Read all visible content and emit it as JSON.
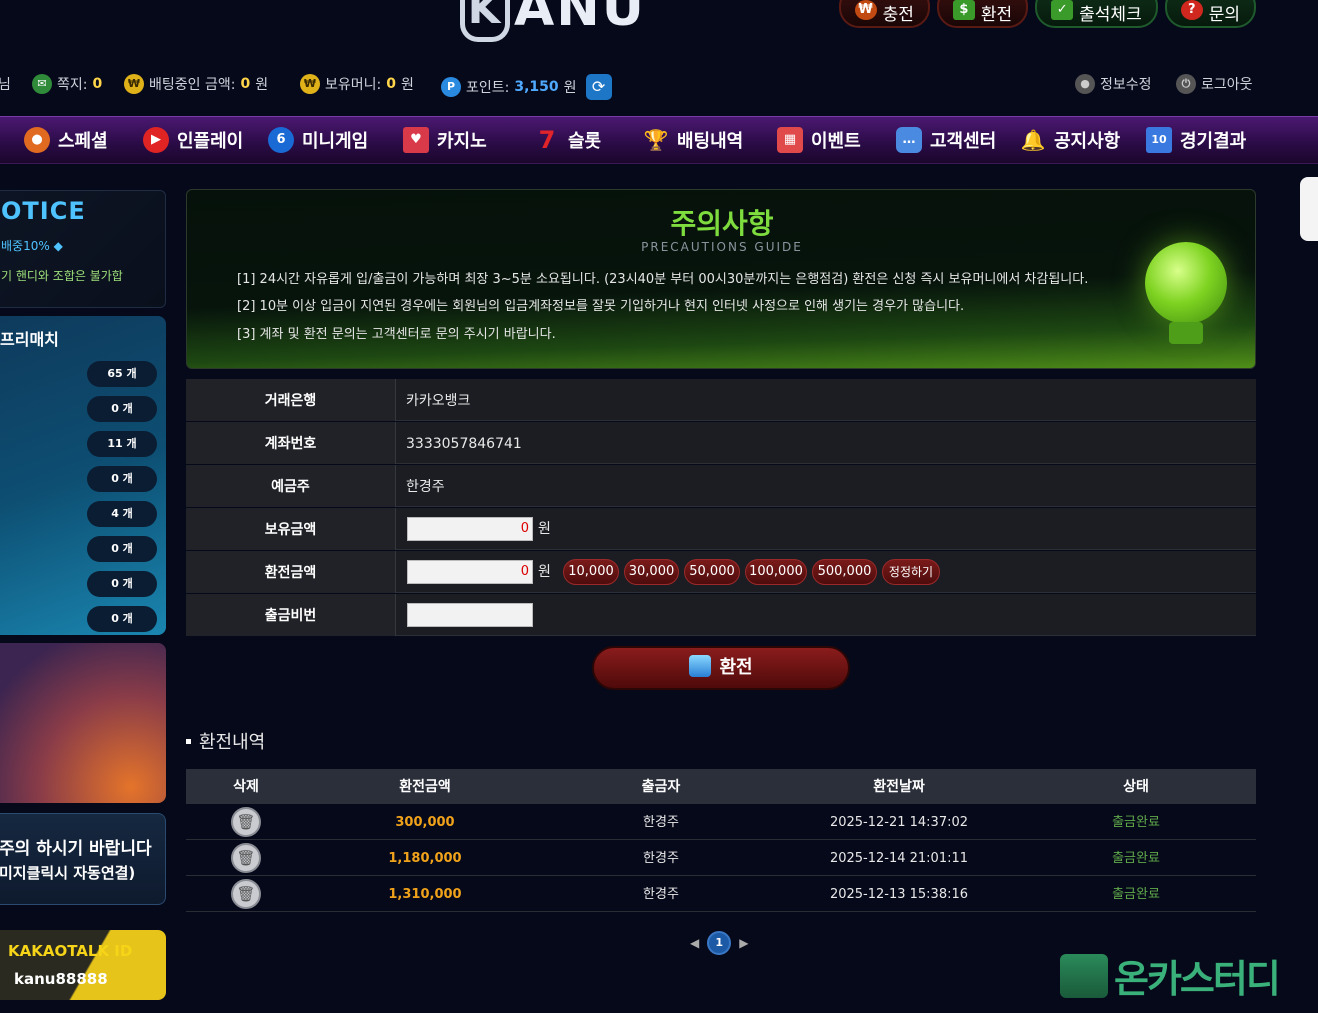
{
  "header": {
    "logo_text": "ANU",
    "top_buttons": [
      {
        "label": "충전",
        "icon": "charge-icon",
        "color": "#c14a12"
      },
      {
        "label": "환전",
        "icon": "exchange-icon",
        "color": "#3a9a2a"
      },
      {
        "label": "출석체크",
        "icon": "attendance-icon",
        "color": "#3a9a2a"
      },
      {
        "label": "문의",
        "icon": "question-icon",
        "color": "#d0281e"
      }
    ]
  },
  "infobar": {
    "user_suffix": "님",
    "messages_label": "쪽지:",
    "messages_value": "0",
    "betting_label": "배팅중인 금액:",
    "betting_value": "0",
    "betting_unit": "원",
    "money_label": "보유머니:",
    "money_value": "0",
    "money_unit": "원",
    "point_label": "포인트:",
    "point_value": "3,150",
    "point_unit": "원",
    "edit_profile": "정보수정",
    "logout": "로그아웃"
  },
  "nav": [
    {
      "label": "스페셜",
      "icon": "basketball-icon",
      "color": "#e06a20"
    },
    {
      "label": "인플레이",
      "icon": "play-icon",
      "color": "#e02424"
    },
    {
      "label": "미니게임",
      "icon": "six-ball-icon",
      "color": "#1a6ad6"
    },
    {
      "label": "카지노",
      "icon": "cards-icon",
      "color": "#d83a4a"
    },
    {
      "label": "슬롯",
      "icon": "seven-icon",
      "color": "#e0242a"
    },
    {
      "label": "배팅내역",
      "icon": "trophy-icon",
      "color": "#e0a21a"
    },
    {
      "label": "이벤트",
      "icon": "calendar-icon",
      "color": "#e04a4a"
    },
    {
      "label": "고객센터",
      "icon": "chat-icon",
      "color": "#4a8ae0"
    },
    {
      "label": "공지사항",
      "icon": "bell-icon",
      "color": "#e0a21a"
    },
    {
      "label": "경기결과",
      "icon": "scoreboard-icon",
      "color": "#3a7ae0"
    }
  ],
  "sidebar": {
    "notice_title": "OTICE",
    "notice_line1": "배중10% ◆",
    "notice_line2": "기 핸디와 조합은 불가합",
    "match_title": "프리매치",
    "match_counts": [
      "65 개",
      "0 개",
      "11 개",
      "0 개",
      "4 개",
      "0 개",
      "0 개",
      "0 개"
    ],
    "banner_line1": "주의 하시기 바랍니다",
    "banner_line2": "미지클릭시 자동연결)",
    "kakao_label": "KAKAOTALK ID",
    "kakao_id": "kanu88888"
  },
  "precautions": {
    "title": "주의사항",
    "subtitle": "PRECAUTIONS GUIDE",
    "lines": [
      "[1]   24시간 자유롭게 입/출금이 가능하며 최장 3~5분 소요됩니다. (23시40분 부터 00시30분까지는 은행점검) 환전은 신청 즉시 보유머니에서 차감됩니다.",
      "[2]   10분 이상 입금이 지연된 경우에는 회원님의 입금계좌정보를 잘못 기입하거나 현지 인터넷 사정으로 인해 생기는 경우가 많습니다.",
      "[3]   계좌 및 환전 문의는 고객센터로 문의 주시기 바랍니다."
    ]
  },
  "form": {
    "bank_label": "거래은행",
    "bank_value": "카카오뱅크",
    "account_label": "계좌번호",
    "account_value": "3333057846741",
    "holder_label": "예금주",
    "holder_value": "한경주",
    "balance_label": "보유금액",
    "balance_value": "0",
    "amount_label": "환전금액",
    "amount_value": "0",
    "won": "원",
    "amount_buttons": [
      "10,000",
      "30,000",
      "50,000",
      "100,000",
      "500,000",
      "정정하기"
    ],
    "pin_label": "출금비번",
    "pin_value": "",
    "submit_label": "환전"
  },
  "history": {
    "title": "환전내역",
    "columns": [
      "삭제",
      "환전금액",
      "출금자",
      "환전날짜",
      "상태"
    ],
    "rows": [
      {
        "amount": "300,000",
        "holder": "한경주",
        "date": "2025-12-21 14:37:02",
        "status": "출금완료"
      },
      {
        "amount": "1,180,000",
        "holder": "한경주",
        "date": "2025-12-14 21:01:11",
        "status": "출금완료"
      },
      {
        "amount": "1,310,000",
        "holder": "한경주",
        "date": "2025-12-13 15:38:16",
        "status": "출금완료"
      }
    ],
    "page": "1"
  },
  "watermark": "온카스터디"
}
